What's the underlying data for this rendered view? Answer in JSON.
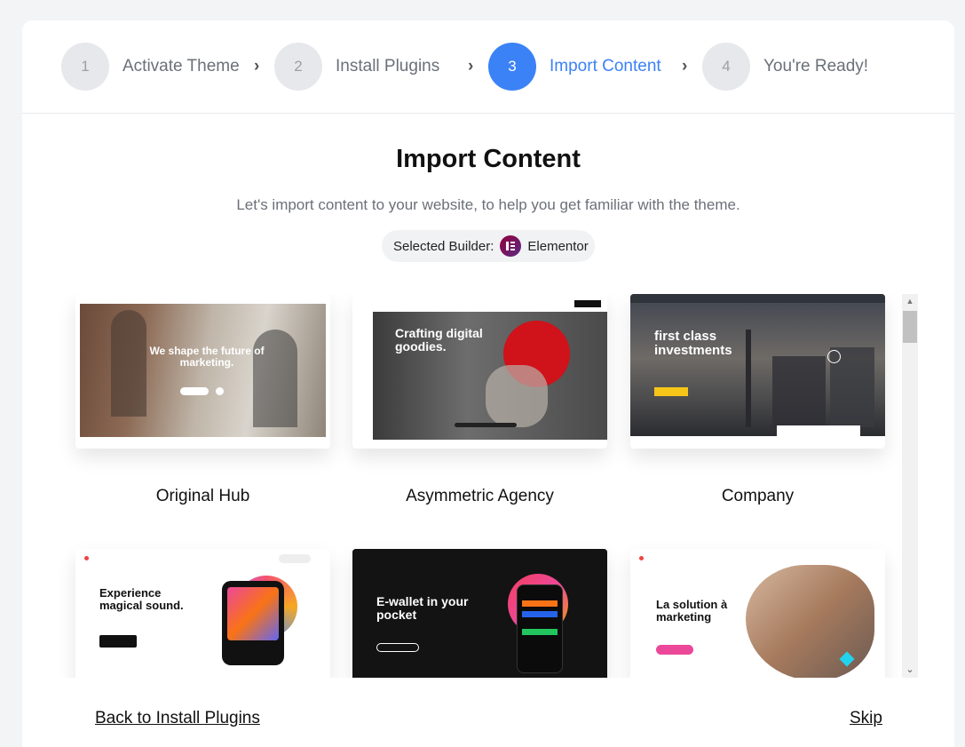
{
  "steps": [
    {
      "number": "1",
      "label": "Activate Theme"
    },
    {
      "number": "2",
      "label": "Install Plugins"
    },
    {
      "number": "3",
      "label": "Import Content"
    },
    {
      "number": "4",
      "label": "You're Ready!"
    }
  ],
  "active_step": 3,
  "page": {
    "title": "Import Content",
    "subtitle": "Let's import content to your website, to help you get familiar with the theme."
  },
  "builder": {
    "prefix": "Selected Builder:",
    "name": "Elementor",
    "icon": "elementor-icon"
  },
  "demos": [
    {
      "name": "Original Hub",
      "headline": "We shape the future of marketing."
    },
    {
      "name": "Asymmetric Agency",
      "headline": "Crafting digital goodies."
    },
    {
      "name": "Company",
      "headline": "first class investments"
    },
    {
      "name": "",
      "headline": "Experience magical sound."
    },
    {
      "name": "",
      "headline": "E-wallet in your pocket"
    },
    {
      "name": "",
      "headline": "La solution à marketing"
    }
  ],
  "footer": {
    "back_label": "Back to Install Plugins",
    "skip_label": "Skip"
  },
  "colors": {
    "accent": "#3b82f6",
    "inactive_circle": "#e7e8eb"
  }
}
